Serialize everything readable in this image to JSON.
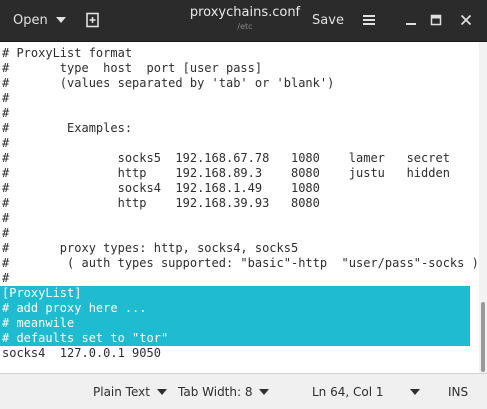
{
  "header": {
    "open_label": "Open",
    "title": "proxychains.conf",
    "subtitle": "/etc",
    "save_label": "Save",
    "icons": {
      "new_document": "new-document-icon",
      "menu": "hamburger-menu-icon",
      "minimize": "minimize-icon",
      "maximize": "maximize-icon",
      "close": "close-icon"
    }
  },
  "editor": {
    "lines": [
      "# ProxyList format",
      "#       type  host  port [user pass]",
      "#       (values separated by 'tab' or 'blank')",
      "#",
      "#",
      "#        Examples:",
      "#",
      "#               socks5  192.168.67.78   1080    lamer   secret",
      "#               http    192.168.89.3    8080    justu   hidden",
      "#               socks4  192.168.1.49    1080",
      "#               http    192.168.39.93   8080",
      "#",
      "#",
      "#       proxy types: http, socks4, socks5",
      "#        ( auth types supported: \"basic\"-http  \"user/pass\"-socks )",
      "#",
      "[ProxyList]",
      "# add proxy here ...",
      "# meanwile",
      "# defaults set to \"tor\"",
      "socks4  127.0.0.1 9050"
    ],
    "selection_color": "#1fbbd0"
  },
  "statusbar": {
    "language": "Plain Text",
    "tab_width": "Tab Width: 8",
    "position": "Ln 64, Col 1",
    "mode": "INS"
  }
}
